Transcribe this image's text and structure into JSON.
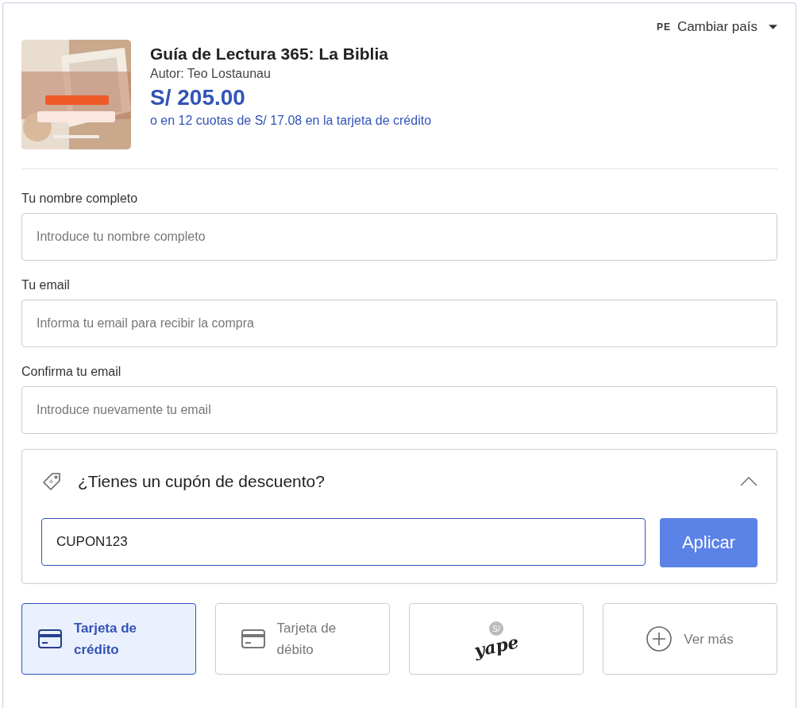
{
  "country": {
    "code": "PE",
    "label": "Cambiar país"
  },
  "product": {
    "title": "Guía de Lectura 365: La Biblia",
    "author": "Autor: Teo Lostaunau",
    "price": "S/ 205.00",
    "installments": "o en 12 cuotas de S/ 17.08 en la tarjeta de crédito"
  },
  "fields": [
    {
      "label": "Tu nombre completo",
      "placeholder": "Introduce tu nombre completo"
    },
    {
      "label": "Tu email",
      "placeholder": "Informa tu email para recibir la compra"
    },
    {
      "label": "Confirma tu email",
      "placeholder": "Introduce nuevamente tu email"
    }
  ],
  "coupon": {
    "title": "¿Tienes un cupón de descuento?",
    "expanded": true,
    "value": "CUPON123",
    "button": "Aplicar"
  },
  "payment_methods": [
    {
      "kind": "card",
      "label": "Tarjeta de crédito",
      "selected": true
    },
    {
      "kind": "card",
      "label": "Tarjeta de débito",
      "selected": false
    },
    {
      "kind": "logo",
      "label": "yape",
      "badge": "S/",
      "selected": false
    },
    {
      "kind": "more",
      "label": "Ver más",
      "selected": false
    }
  ]
}
